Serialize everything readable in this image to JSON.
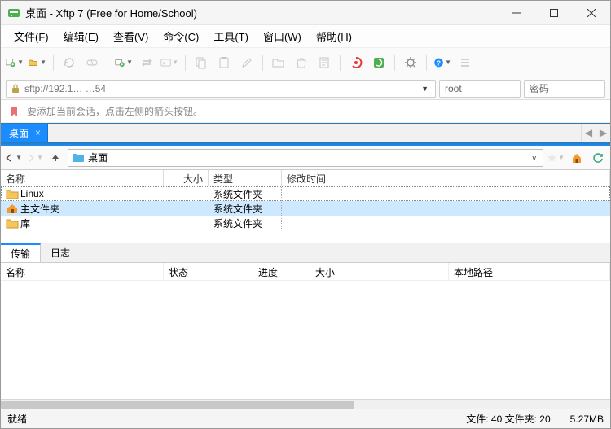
{
  "window": {
    "title": "桌面 - Xftp 7 (Free for Home/School)"
  },
  "menu": {
    "file": "文件(F)",
    "edit": "编辑(E)",
    "view": "查看(V)",
    "command": "命令(C)",
    "tools": "工具(T)",
    "window": "窗口(W)",
    "help": "帮助(H)"
  },
  "connection": {
    "host": "sftp://192.1…      …54",
    "user": "root",
    "password_placeholder": "密码"
  },
  "hint": "要添加当前会话，点击左侧的箭头按钮。",
  "tab": {
    "label": "桌面"
  },
  "path": "桌面",
  "columns": {
    "name": "名称",
    "size": "大小",
    "type": "类型",
    "modified": "修改时间"
  },
  "rows": [
    {
      "name": "Linux",
      "type": "系统文件夹",
      "icon": "folder",
      "dotted": true,
      "sel": false
    },
    {
      "name": "主文件夹",
      "type": "系统文件夹",
      "icon": "home",
      "dotted": false,
      "sel": true
    },
    {
      "name": "库",
      "type": "系统文件夹",
      "icon": "library",
      "dotted": false,
      "sel": false
    }
  ],
  "bottom_tabs": {
    "transfer": "传输",
    "log": "日志"
  },
  "transfer_cols": {
    "name": "名称",
    "status": "状态",
    "progress": "进度",
    "size": "大小",
    "local": "本地路径"
  },
  "status": {
    "ready": "就绪",
    "files": "文件: 40 文件夹: 20",
    "size": "5.27MB"
  }
}
